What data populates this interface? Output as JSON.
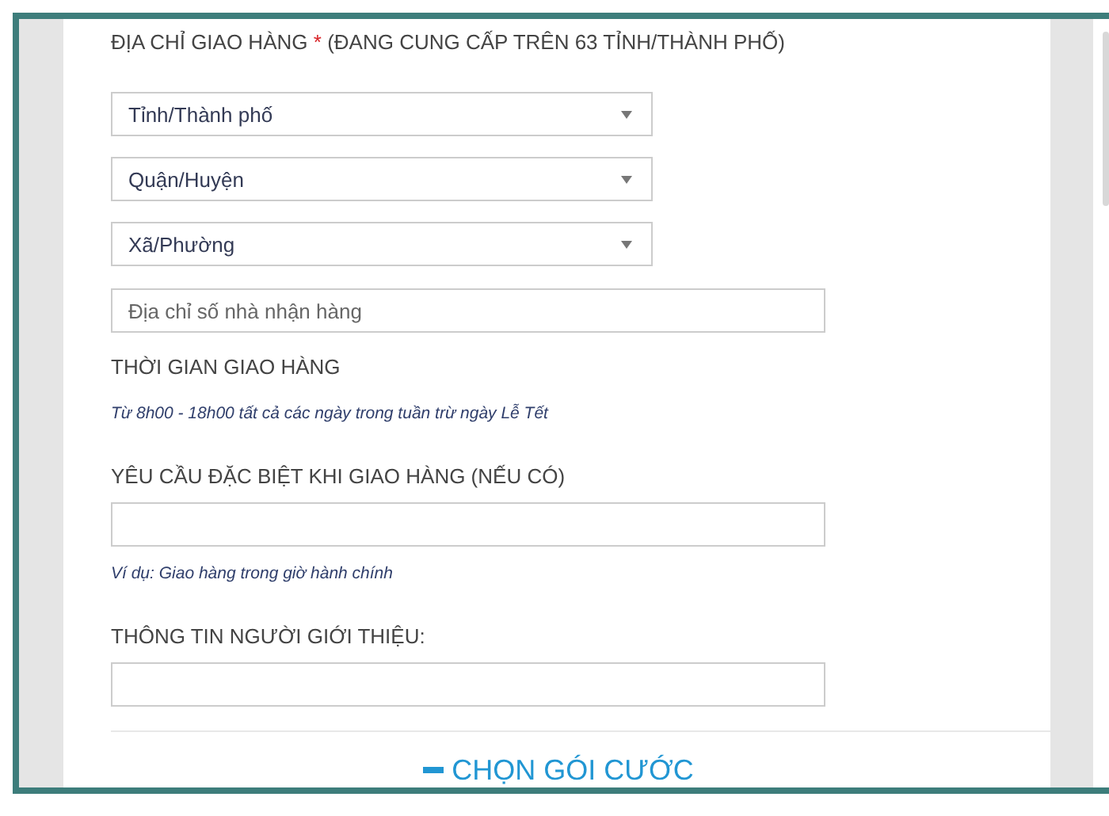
{
  "address": {
    "label": "ĐỊA CHỈ GIAO HÀNG",
    "required_mark": "*",
    "note": "(ĐANG CUNG CẤP TRÊN 63 TỈNH/THÀNH PHỐ)",
    "selects": [
      {
        "placeholder": "Tỉnh/Thành phố"
      },
      {
        "placeholder": "Quận/Huyện"
      },
      {
        "placeholder": "Xã/Phường"
      }
    ],
    "street": {
      "placeholder": "Địa chỉ số nhà nhận hàng"
    }
  },
  "delivery_time": {
    "label": "THỜI GIAN GIAO HÀNG",
    "hint": "Từ 8h00 - 18h00 tất cả các ngày trong tuần trừ ngày Lễ Tết"
  },
  "special_request": {
    "label": "YÊU CẦU ĐẶC BIỆT KHI GIAO HÀNG (NẾU CÓ)",
    "hint": "Ví dụ: Giao hàng trong giờ hành chính"
  },
  "referrer": {
    "label": "THÔNG TIN NGƯỜI GIỚI THIỆU:"
  },
  "section_toggle": {
    "label": "CHỌN GÓI CƯỚC",
    "expanded": true
  }
}
